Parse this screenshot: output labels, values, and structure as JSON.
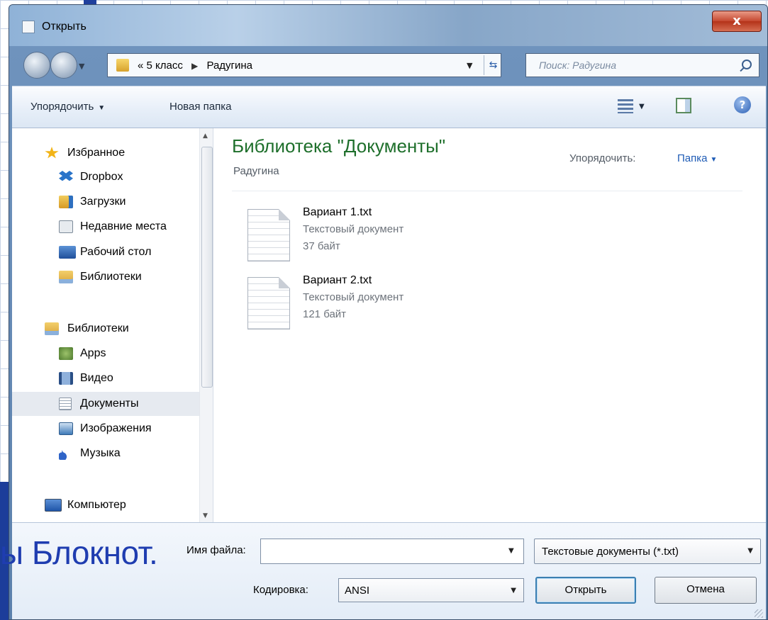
{
  "window": {
    "title": "Открыть",
    "close_label": "x"
  },
  "navigation": {
    "breadcrumb": [
      "5 класс",
      "Радугина"
    ],
    "breadcrumb_prefix": "«",
    "search_placeholder": "Поиск: Радугина"
  },
  "toolbar": {
    "organize_label": "Упорядочить",
    "new_folder_label": "Новая папка",
    "help_label": "?"
  },
  "sidebar": {
    "favorites": [
      {
        "label": "Избранное",
        "icon": "star-icon",
        "color": "#f2b418"
      },
      {
        "label": "Dropbox",
        "icon": "dropbox-icon",
        "color": "#2a74c9"
      },
      {
        "label": "Загрузки",
        "icon": "downloads-folder-icon",
        "color": "#e0a928"
      },
      {
        "label": "Недавние места",
        "icon": "recent-places-icon",
        "color": "#7c8a99"
      },
      {
        "label": "Рабочий стол",
        "icon": "desktop-icon",
        "color": "#2d5fa8"
      },
      {
        "label": "Библиотеки",
        "icon": "libraries-icon",
        "color": "#e5b23a"
      }
    ],
    "libraries": [
      {
        "label": "Библиотеки",
        "icon": "libraries-icon",
        "color": "#e5b23a"
      },
      {
        "label": "Apps",
        "icon": "apps-icon",
        "color": "#6d9a44"
      },
      {
        "label": "Видео",
        "icon": "video-icon",
        "color": "#3d6aa8"
      },
      {
        "label": "Документы",
        "icon": "documents-icon",
        "color": "#9aa7b6",
        "selected": true
      },
      {
        "label": "Изображения",
        "icon": "images-icon",
        "color": "#3f7ab8"
      },
      {
        "label": "Музыка",
        "icon": "music-icon",
        "color": "#2f64c8"
      }
    ],
    "computer": [
      {
        "label": "Компьютер",
        "icon": "computer-icon",
        "color": "#2a6ac4"
      }
    ]
  },
  "content": {
    "library_title": "Библиотека \"Документы\"",
    "library_subtitle": "Радугина",
    "arrange_label": "Упорядочить:",
    "arrange_value": "Папка",
    "files": [
      {
        "name": "Вариант 1.txt",
        "type": "Текстовый документ",
        "size": "37 байт"
      },
      {
        "name": "Вариант 2.txt",
        "type": "Текстовый документ",
        "size": "121 байт"
      }
    ]
  },
  "footer": {
    "filename_label": "Имя файла:",
    "filename_value": "",
    "filetype_value": "Текстовые документы (*.txt)",
    "encoding_label": "Кодировка:",
    "encoding_value": "ANSI",
    "open_label": "Открыть",
    "cancel_label": "Отмена"
  },
  "background": {
    "slide_text": "ы Блокнот."
  },
  "colors": {
    "library_title": "#1e6f2b",
    "link": "#1e5bb5",
    "slide_text": "#1f3db0"
  }
}
